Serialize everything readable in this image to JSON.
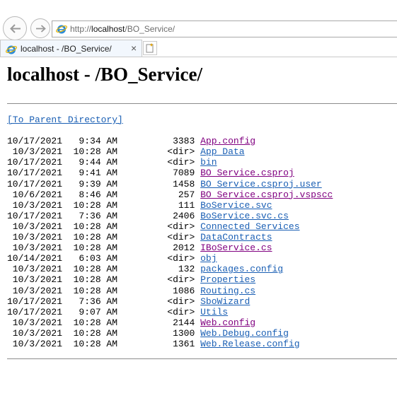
{
  "browser": {
    "url_prefix": "http://",
    "url_host": "localhost",
    "url_path": "/BO_Service/",
    "tab_title": "localhost - /BO_Service/",
    "tab_close": "×"
  },
  "page": {
    "heading": "localhost - /BO_Service/",
    "parent_link": "[To Parent Directory]"
  },
  "listing": [
    {
      "date": "10/17/2021",
      "time": " 9:34 AM",
      "size": "3383",
      "name": "App.config",
      "visited": true
    },
    {
      "date": " 10/3/2021",
      "time": "10:28 AM",
      "size": "<dir>",
      "name": "App_Data",
      "visited": false
    },
    {
      "date": "10/17/2021",
      "time": " 9:44 AM",
      "size": "<dir>",
      "name": "bin",
      "visited": false
    },
    {
      "date": "10/17/2021",
      "time": " 9:41 AM",
      "size": "7089",
      "name": "BO_Service.csproj",
      "visited": true
    },
    {
      "date": "10/17/2021",
      "time": " 9:39 AM",
      "size": "1458",
      "name": "BO_Service.csproj.user",
      "visited": false
    },
    {
      "date": " 10/6/2021",
      "time": " 8:46 AM",
      "size": "257",
      "name": "BO_Service.csproj.vspscc",
      "visited": true
    },
    {
      "date": " 10/3/2021",
      "time": "10:28 AM",
      "size": "111",
      "name": "BoService.svc",
      "visited": false
    },
    {
      "date": "10/17/2021",
      "time": " 7:36 AM",
      "size": "2406",
      "name": "BoService.svc.cs",
      "visited": false
    },
    {
      "date": " 10/3/2021",
      "time": "10:28 AM",
      "size": "<dir>",
      "name": "Connected Services",
      "visited": false
    },
    {
      "date": " 10/3/2021",
      "time": "10:28 AM",
      "size": "<dir>",
      "name": "DataContracts",
      "visited": false
    },
    {
      "date": " 10/3/2021",
      "time": "10:28 AM",
      "size": "2012",
      "name": "IBoService.cs",
      "visited": true
    },
    {
      "date": "10/14/2021",
      "time": " 6:03 AM",
      "size": "<dir>",
      "name": "obj",
      "visited": false
    },
    {
      "date": " 10/3/2021",
      "time": "10:28 AM",
      "size": "132",
      "name": "packages.config",
      "visited": false
    },
    {
      "date": " 10/3/2021",
      "time": "10:28 AM",
      "size": "<dir>",
      "name": "Properties",
      "visited": false
    },
    {
      "date": " 10/3/2021",
      "time": "10:28 AM",
      "size": "1086",
      "name": "Routing.cs",
      "visited": false
    },
    {
      "date": "10/17/2021",
      "time": " 7:36 AM",
      "size": "<dir>",
      "name": "SboWizard",
      "visited": false
    },
    {
      "date": "10/17/2021",
      "time": " 9:07 AM",
      "size": "<dir>",
      "name": "Utils",
      "visited": false
    },
    {
      "date": " 10/3/2021",
      "time": "10:28 AM",
      "size": "2144",
      "name": "Web.config",
      "visited": true
    },
    {
      "date": " 10/3/2021",
      "time": "10:28 AM",
      "size": "1300",
      "name": "Web.Debug.config",
      "visited": false
    },
    {
      "date": " 10/3/2021",
      "time": "10:28 AM",
      "size": "1361",
      "name": "Web.Release.config",
      "visited": false
    }
  ],
  "colors": {
    "link": "#1a5fb4",
    "visited_link": "#800080"
  },
  "icons": {
    "back": "back-arrow-icon",
    "forward": "forward-arrow-icon",
    "site": "ie-page-icon",
    "new_tab": "new-tab-icon"
  }
}
